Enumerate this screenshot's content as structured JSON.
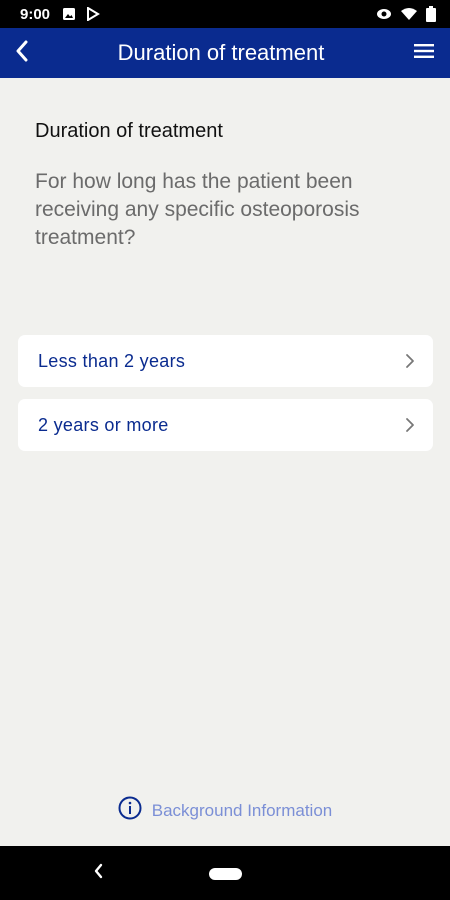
{
  "status_bar": {
    "time": "9:00",
    "left_icons": [
      "image-icon",
      "play-store-icon"
    ],
    "right_icons": [
      "eye-icon",
      "wifi-icon",
      "battery-icon"
    ]
  },
  "app_bar": {
    "title": "Duration of treatment",
    "back_icon": "chevron-left-icon",
    "menu_icon": "menu-icon",
    "color": "#0a2b8f"
  },
  "main": {
    "heading": "Duration of treatment",
    "question": "For how long has the patient been receiving any specific osteoporosis treatment?",
    "options": [
      {
        "label": "Less than 2 years",
        "icon": "chevron-right-icon"
      },
      {
        "label": "2 years or more",
        "icon": "chevron-right-icon"
      }
    ]
  },
  "footer": {
    "background_info_label": "Background Information",
    "icon": "info-icon"
  },
  "colors": {
    "accent": "#0a2b8f",
    "background": "#f1f1ee",
    "link": "#7b8fd6"
  }
}
